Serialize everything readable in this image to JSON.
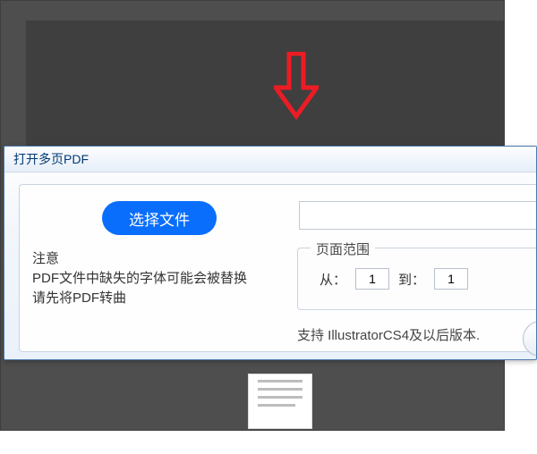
{
  "dialog": {
    "title": "打开多页PDF",
    "select_file_label": "选择文件",
    "filepath_value": "",
    "notice_heading": "注意",
    "notice_line1": "PDF文件中缺失的字体可能会被替换",
    "notice_line2": "请先将PDF转曲",
    "page_range": {
      "legend": "页面范围",
      "from_label": "从：",
      "from_value": "1",
      "to_label": "到：",
      "to_value": "1"
    },
    "support_text": "支持 IllustratorCS4及以后版本."
  },
  "arrow": {
    "color": "#ec1c24"
  }
}
